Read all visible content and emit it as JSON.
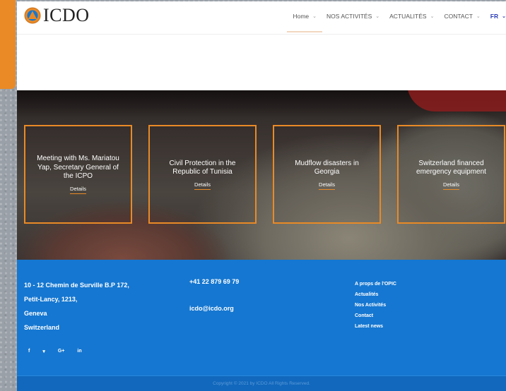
{
  "colors": {
    "accent": "#e98a26",
    "footer": "#1577d1",
    "lang": "#2d3fb8"
  },
  "header": {
    "logo_text": "ICDO",
    "nav": [
      {
        "label": "Home"
      },
      {
        "label": "NOS ACTIVITÉS"
      },
      {
        "label": "ACTUALITÉS"
      },
      {
        "label": "CONTACT"
      },
      {
        "label": "FR"
      }
    ]
  },
  "cards": [
    {
      "title": "Meeting with Ms. Mariatou Yap, Secretary General of the ICPO",
      "link": "Details"
    },
    {
      "title": "Civil Protection in the Republic of Tunisia",
      "link": "Details"
    },
    {
      "title": "Mudflow disasters in Georgia",
      "link": "Details"
    },
    {
      "title": "Switzerland financed emergency equipment",
      "link": "Details"
    }
  ],
  "footer": {
    "address": [
      "10 - 12 Chemin de Surville B.P 172,",
      "Petit-Lancy, 1213,",
      "Geneva",
      "Switzerland"
    ],
    "phone": "+41 22 879 69 79",
    "email": "icdo@icdo.org",
    "links": [
      "A props de l'OPIC",
      "Actualités",
      "Nos Activités",
      "Contact",
      "Latest news"
    ],
    "social": [
      "f",
      "▾",
      "G+",
      "in"
    ],
    "copyright": "Copyright © 2021 by ICDO All Rights Reserved."
  }
}
